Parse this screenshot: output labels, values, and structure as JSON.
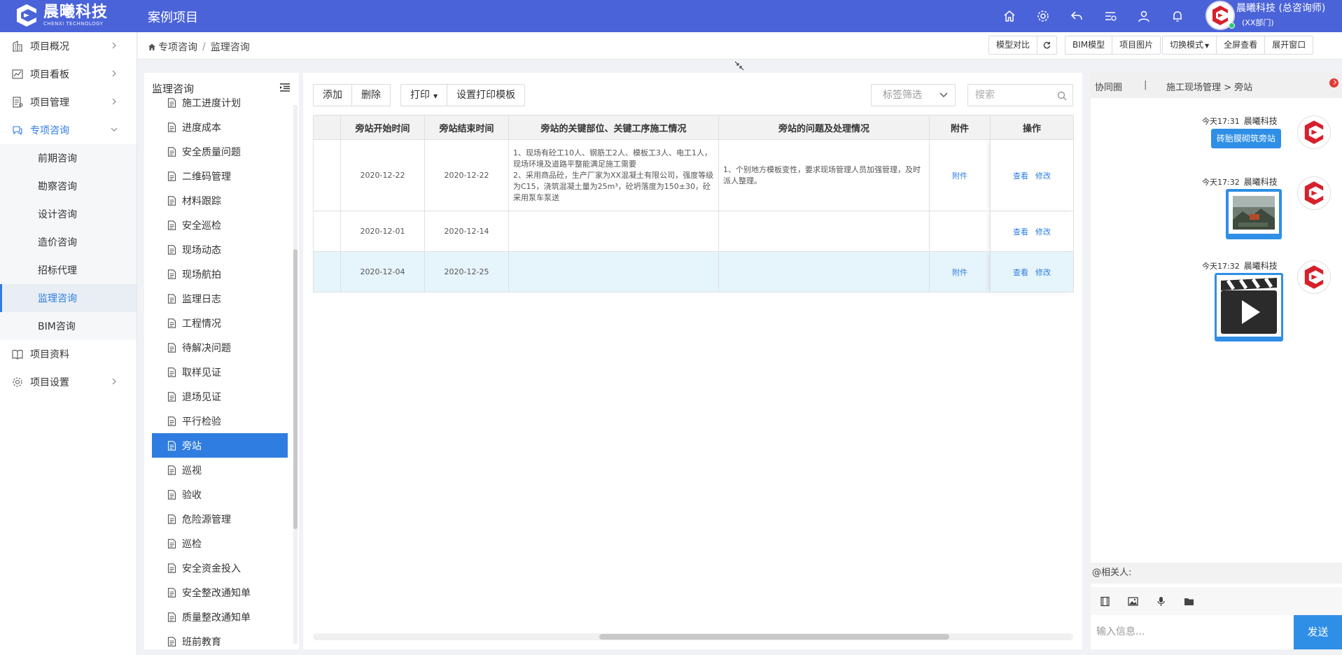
{
  "app": {
    "logo_cn": "晨曦科技",
    "logo_en": "CHENXI TECHNOLOGY",
    "title": "案例项目"
  },
  "user": {
    "name": "晨曦科技 (总咨询师)",
    "dept": "(XX部门)"
  },
  "top_icons": [
    "home-icon",
    "gear-icon",
    "back-icon",
    "list-icon",
    "user-icon",
    "bell-icon"
  ],
  "sidebar": {
    "items": [
      {
        "label": "项目概况",
        "icon": "building-icon",
        "chevron": "right"
      },
      {
        "label": "项目看板",
        "icon": "chart-icon",
        "chevron": "right"
      },
      {
        "label": "项目管理",
        "icon": "document-icon",
        "chevron": "right"
      },
      {
        "label": "专项咨询",
        "icon": "chat-icon",
        "chevron": "down"
      },
      {
        "label": "项目资料",
        "icon": "book-icon",
        "chevron": "none"
      },
      {
        "label": "项目设置",
        "icon": "gear-icon",
        "chevron": "right"
      }
    ],
    "subitems": [
      "前期咨询",
      "勘察咨询",
      "设计咨询",
      "造价咨询",
      "招标代理",
      "监理咨询",
      "BIM咨询"
    ],
    "active_sub": "监理咨询"
  },
  "breadcrumb": {
    "home": "专项咨询",
    "current": "监理咨询"
  },
  "toolbar": {
    "model_compare": "模型对比",
    "bim_model": "BIM模型",
    "project_images": "项目图片",
    "switch_mode": "切换模式",
    "fullscreen": "全屏查看",
    "expand_window": "展开窗口"
  },
  "tree": {
    "title": "监理咨询",
    "items": [
      "施工进度计划",
      "进度成本",
      "安全质量问题",
      "二维码管理",
      "材料跟踪",
      "安全巡检",
      "现场动态",
      "现场航拍",
      "监理日志",
      "工程情况",
      "待解决问题",
      "取样见证",
      "退场见证",
      "平行检验",
      "旁站",
      "巡视",
      "验收",
      "危险源管理",
      "巡检",
      "安全资金投入",
      "安全整改通知单",
      "质量整改通知单",
      "班前教育"
    ],
    "active": "旁站"
  },
  "actions": {
    "add": "添加",
    "delete": "删除",
    "print": "打印",
    "print_template": "设置打印模板",
    "filter_placeholder": "标签筛选",
    "search_placeholder": "搜索"
  },
  "table": {
    "headers": [
      "",
      "旁站开始时间",
      "旁站结束时间",
      "旁站的关键部位、关键工序施工情况",
      "旁站的问题及处理情况",
      "附件",
      "操作"
    ],
    "rows": [
      {
        "start": "2020-12-22",
        "end": "2020-12-22",
        "situation": "1、现场有砼工10人、钢筋工2人、模板工3人、电工1人，现场环境及道路平整能满足施工需要\n2、采用商品砼，生产厂家为XX混凝土有限公司，强度等级为C15，浇筑混凝土量为25m³，砼坍落度为150±30，砼采用泵车泵送",
        "problems": "1、个别地方模板变性，要求现场管理人员加强管理，及时派人整理。",
        "attachment": "附件",
        "view": "查看",
        "edit": "修改",
        "highlight": false
      },
      {
        "start": "2020-12-01",
        "end": "2020-12-14",
        "situation": "",
        "problems": "",
        "attachment": "",
        "view": "查看",
        "edit": "修改",
        "highlight": false
      },
      {
        "start": "2020-12-04",
        "end": "2020-12-25",
        "situation": "",
        "problems": "",
        "attachment": "附件",
        "view": "查看",
        "edit": "修改",
        "highlight": true
      }
    ]
  },
  "chat": {
    "tab": "协同圈",
    "separator": "|",
    "path": "施工现场管理 > 旁站",
    "messages": [
      {
        "time": "今天17:31",
        "sender": "晨曦科技",
        "type": "text",
        "text": "砖胎膜砌筑旁站"
      },
      {
        "time": "今天17:32",
        "sender": "晨曦科技",
        "type": "image"
      },
      {
        "time": "今天17:32",
        "sender": "晨曦科技",
        "type": "video"
      }
    ],
    "mention_label": "@相关人:",
    "input_placeholder": "输入信息...",
    "send_label": "发送",
    "tools": [
      "film-icon",
      "image-icon",
      "microphone-icon",
      "folder-icon"
    ]
  },
  "colors": {
    "brand": "#4a63d9",
    "accent": "#2f7de1",
    "bubble": "#2f8fe6",
    "logo_red": "#d6202c"
  }
}
